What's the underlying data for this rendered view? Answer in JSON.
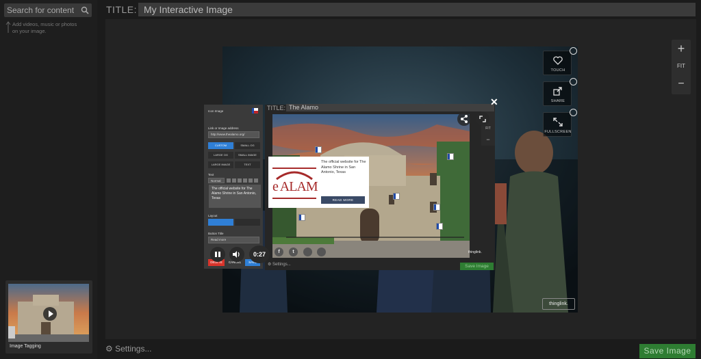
{
  "search": {
    "placeholder": "Search for content"
  },
  "sidebar": {
    "hint": "Add videos, music or photos on your image.",
    "thumbnail_label": "Image Tagging"
  },
  "header": {
    "title_label": "TITLE:",
    "title_value": "My Interactive Image"
  },
  "zoom": {
    "plus": "+",
    "fit": "FIT",
    "minus": "−"
  },
  "stage_buttons": {
    "touch": "TOUCH",
    "share": "SHARE",
    "fullscreen": "FULLSCREEN"
  },
  "watermark": "thinglink.",
  "editor": {
    "icon_image_label": "Icon Image",
    "link_label": "Link or Image address",
    "link_value": "http://www.thealamo.org/",
    "size_buttons": [
      "CUSTOM",
      "SMALL OG",
      "LARGE OG",
      "SMALL IMAGE",
      "LARGE IMAGE",
      "TEXT"
    ],
    "text_label": "Text",
    "format_label": "Normal",
    "text_value": "The official website for The Alamo Shrine in San Antonio, Texas",
    "layout_label": "Layout",
    "button_title_label": "Button Title",
    "button_title_value": "Read more",
    "delete": "DELETE",
    "cancel": "CANCEL",
    "save": "SAVE"
  },
  "media": {
    "time": "0:27"
  },
  "inner": {
    "title_label": "TITLE:",
    "title_value": "The Alamo",
    "fit": "FIT",
    "minus": "−",
    "settings": "Settings...",
    "save": "Save Image",
    "watermark": "thinglink."
  },
  "popup": {
    "logo_text": "e ALAM",
    "text": "The official website for The Alamo Shrine in San Antonio, Texas",
    "button": "READ MORE"
  },
  "social": {
    "facebook": "f",
    "tumblr": "t"
  },
  "footer": {
    "settings": "Settings...",
    "save": "Save Image"
  },
  "colors": {
    "accent_green": "#2e7d32",
    "accent_blue": "#2f7fd6",
    "delete_red": "#d9342b"
  }
}
